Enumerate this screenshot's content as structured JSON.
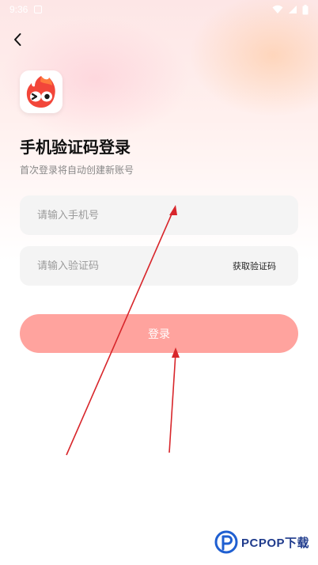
{
  "status_bar": {
    "time": "9:36",
    "icons": [
      "notification-icon",
      "wifi-icon",
      "signal-icon",
      "battery-icon"
    ]
  },
  "header": {
    "back_icon": "chevron-left-icon"
  },
  "logo": {
    "icon": "flame-mascot-icon"
  },
  "login": {
    "title": "手机验证码登录",
    "subtitle": "首次登录将自动创建新账号",
    "phone_placeholder": "请输入手机号",
    "phone_value": "",
    "code_placeholder": "请输入验证码",
    "code_value": "",
    "get_code_label": "获取验证码",
    "submit_label": "登录"
  },
  "watermark": {
    "text": "PCPOP下载"
  },
  "colors": {
    "accent_button": "#ffa39e",
    "annotation_arrow": "#d8262b",
    "field_background": "#f4f4f4"
  }
}
